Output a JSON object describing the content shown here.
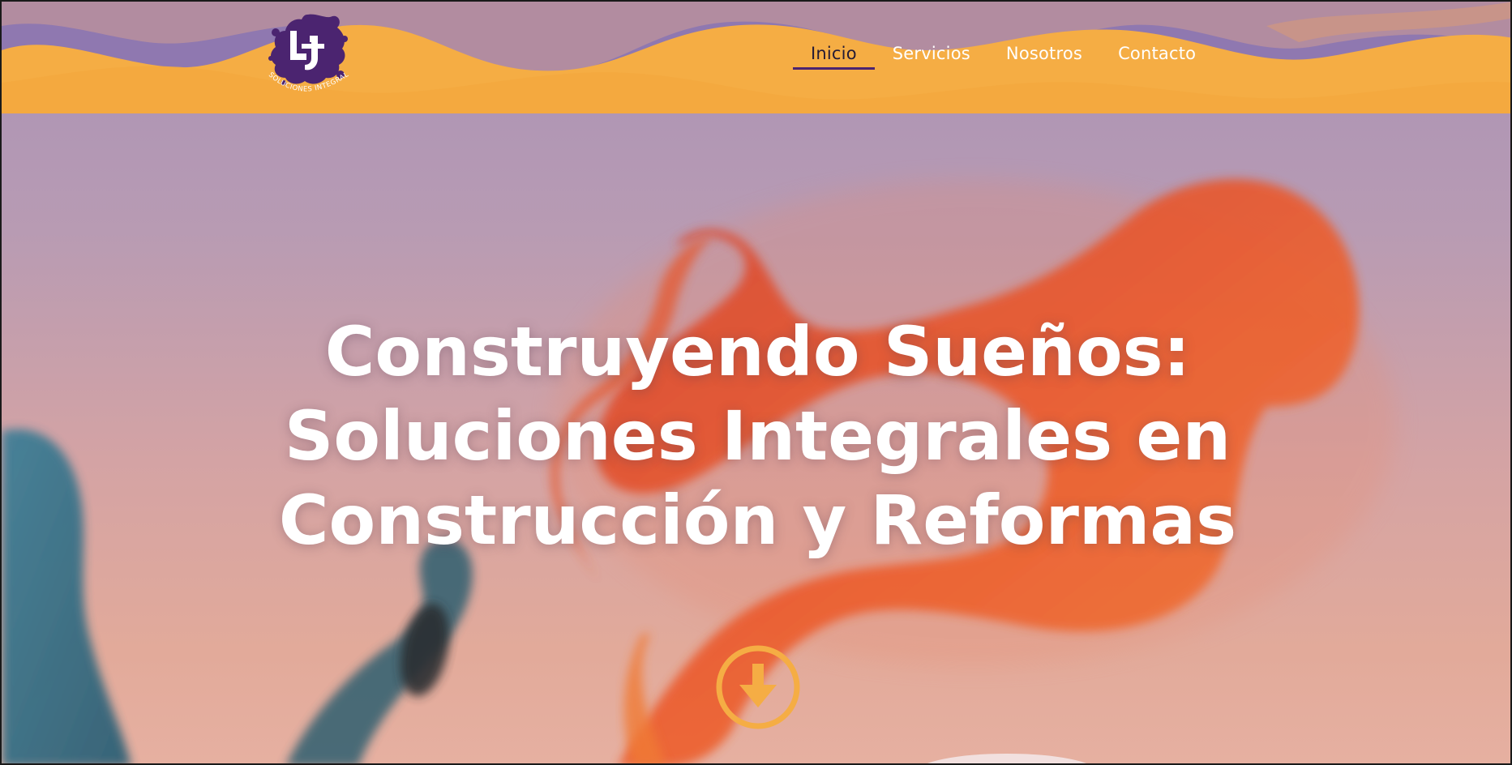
{
  "brand": {
    "logo_initials": "LJ",
    "logo_text": "SOLUCIONES INTEGRALES",
    "colors": {
      "purple": "#4b2470",
      "orange": "#f5ad44",
      "lavender": "#8f78b0"
    }
  },
  "nav": {
    "items": [
      {
        "label": "Inicio",
        "active": true
      },
      {
        "label": "Servicios",
        "active": false
      },
      {
        "label": "Nosotros",
        "active": false
      },
      {
        "label": "Contacto",
        "active": false
      }
    ]
  },
  "hero": {
    "headline_lines": [
      "Construyendo Sueños:",
      "Soluciones Integrales en",
      "Construcción y Reformas"
    ],
    "scroll_icon": "arrow-down-circle-icon",
    "accent": "#f5ad44"
  }
}
